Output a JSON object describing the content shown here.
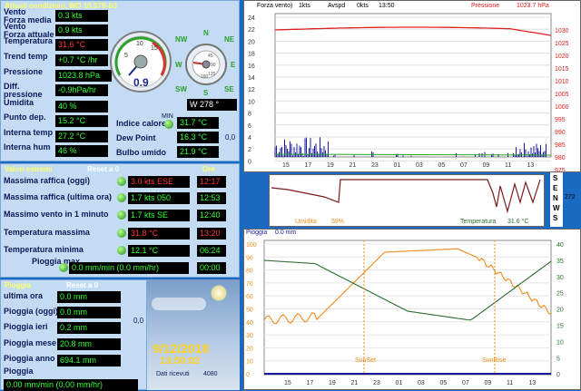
{
  "current": {
    "title": "Attuali condizioni, WD 10.37S-b3",
    "rows": [
      {
        "label": "Vento\nForza media",
        "value": "0.3 kts",
        "red": false
      },
      {
        "label": "Vento\nForza attuale",
        "value": "0.9 kts",
        "red": false
      },
      {
        "label": "Temperatura",
        "value": "31.6 °C",
        "red": true
      },
      {
        "label": "Trend temp",
        "value": "+0.7 °C /hr",
        "red": false
      },
      {
        "label": "Pressione",
        "value": "1023.8 hPa",
        "red": false
      },
      {
        "label": "Diff.\npressione",
        "value": "-0.9hPa/hr",
        "red": false
      },
      {
        "label": "Umidita",
        "value": "40 %",
        "red": false
      },
      {
        "label": "Punto dep.",
        "value": "15.2 °C",
        "red": false
      },
      {
        "label": "Interna temp",
        "value": "27.2 °C",
        "red": false
      },
      {
        "label": "Interna hum",
        "value": "46 %",
        "red": false
      }
    ],
    "gauge_speed": "0.9",
    "gauge_ticks": [
      "5",
      "10",
      "15"
    ],
    "compass": {
      "n": "N",
      "ne": "NE",
      "e": "E",
      "se": "SE",
      "s": "S",
      "sw": "SW",
      "w": "W",
      "nw": "NW"
    },
    "compass_ticks": [
      "45",
      "90",
      "135",
      "180"
    ],
    "direction": "W  278 °",
    "indice_label": "Indice calore",
    "indice_value": "31.7 °C",
    "min_label": "MIN",
    "dew_label": "Dew Point",
    "dew_value": "16.3 °C",
    "bulbo_label": "Bulbo umido",
    "bulbo_value": "21.9 °C",
    "side_value": "0,0"
  },
  "extremes": {
    "title": "Valori estremi",
    "reset": "Reset a 0",
    "time_title": "Ore",
    "rows": [
      {
        "label": "Massima raffica (oggi)",
        "value": "3.0 kts ESE",
        "time": "12:17",
        "red": true
      },
      {
        "label": "Massima raffica (ultima ora)",
        "value": "1.7 kts 050",
        "time": "12:53",
        "red": false
      },
      {
        "label": "Massimo vento in 1 minuto",
        "value": "1.7 kts  SE",
        "time": "12:40",
        "red": false
      },
      {
        "label": "Temperatura massima",
        "value": "31.8 °C",
        "time": "13:20",
        "red": true
      },
      {
        "label": "Temperatura minima",
        "value": "12.1 °C",
        "time": "06:24",
        "red": false
      },
      {
        "label": "Pioggia max",
        "value": "0.0 mm/min (0.0 mm/hr)",
        "time": "00:00",
        "red": false
      }
    ]
  },
  "rain": {
    "title": "Pioggia",
    "reset": "Reset a 0",
    "rows": [
      {
        "label": "ultima ora",
        "value": "0.0 mm"
      },
      {
        "label": "Pioggia (oggi)",
        "value": "0.0 mm"
      },
      {
        "label": "Pioggia ieri",
        "value": "0.2 mm"
      },
      {
        "label": "Pioggia mese",
        "value": "20.8 mm"
      },
      {
        "label": "Pioggia anno",
        "value": "694.1 mm"
      },
      {
        "label": "Pioggia",
        "value": "0.00 mm/min (0.00 mm/hr)"
      }
    ],
    "side_value": "0,0"
  },
  "status": {
    "date": "9/12/2018",
    "time": "13:50:02",
    "received_label": "Dati ricevuti",
    "received_value": "4080"
  },
  "graph1": {
    "header_wind": "Forza vento)",
    "header_kts": "1kts",
    "header_avg": "Avspd",
    "header_avg_val": "0kts",
    "header_time": "13:50",
    "header_press": "Pressione",
    "header_press_val": "1023.7 hPa",
    "left_ticks": [
      "24",
      "22",
      "20",
      "18",
      "16",
      "14",
      "12",
      "10",
      "8",
      "6",
      "4",
      "2",
      "0"
    ],
    "right_ticks": [
      "1030",
      "1025",
      "1020",
      "1015",
      "1010",
      "1005",
      "1000",
      "995",
      "990",
      "985",
      "980",
      "975"
    ],
    "x_ticks": [
      "15",
      "17",
      "19",
      "21",
      "23",
      "01",
      "03",
      "05",
      "07",
      "09",
      "11",
      "13"
    ]
  },
  "graph2": {
    "compass": [
      "S",
      "E",
      "N",
      "W",
      "S"
    ],
    "dir_value": "272",
    "left_label": "Umidita",
    "left_value": "58%",
    "right_label": "Temperatura",
    "right_value": "31.6 °C"
  },
  "graph3": {
    "title": "Pioggia",
    "rain_value": "0.0 mm",
    "left_ticks": [
      "100",
      "90",
      "80",
      "70",
      "60",
      "50",
      "40",
      "30",
      "20",
      "10",
      "0"
    ],
    "right_ticks": [
      "40",
      "35",
      "30",
      "25",
      "20",
      "15",
      "10",
      "5",
      "0"
    ],
    "sunset": "SunSet",
    "sunrise": "SunRise",
    "x_ticks": [
      "15",
      "17",
      "19",
      "21",
      "23",
      "01",
      "03",
      "05",
      "07",
      "09",
      "11",
      "13"
    ]
  },
  "colors": {
    "accent": "#1a6ac2",
    "panel": "#c3dbf3",
    "led_on": "#33ff33",
    "warn": "#ff3333",
    "pressure": "#e02020",
    "wind": "#1a1aa0",
    "temp": "#2e6b2e",
    "hum": "#f08a1a"
  }
}
